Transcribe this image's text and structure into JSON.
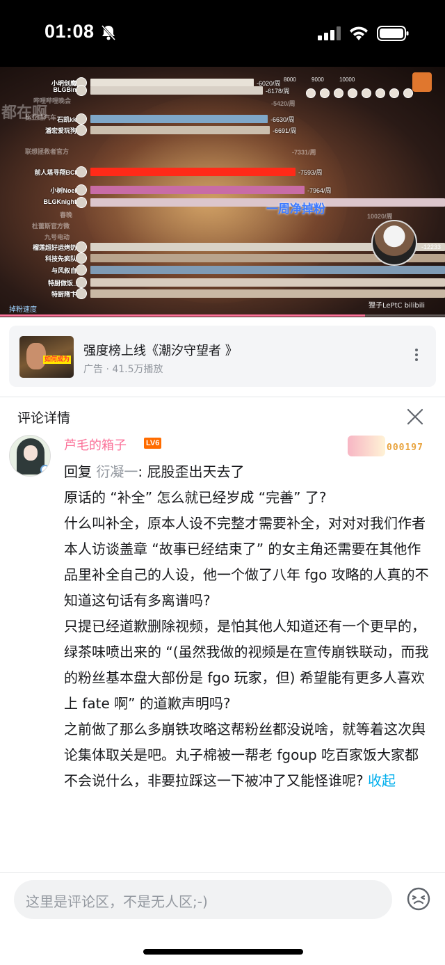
{
  "status": {
    "time": "01:08"
  },
  "video": {
    "axis_ticks": [
      "8000",
      "9000",
      "10000"
    ],
    "ghost_text": "都在啊",
    "bars": [
      {
        "name": "小明剑魔",
        "value": "-6020/周",
        "color": "#e8e2d8"
      },
      {
        "name": "BLGBin",
        "value": "-6178/周",
        "color": "#d8d0c6"
      },
      {
        "name": "石凯kk",
        "value": "-6630/周",
        "color": "#7fa7c8"
      },
      {
        "name": "潘宏爱玩狗",
        "value": "-6691/周",
        "color": "#cbbfae"
      },
      {
        "name": "前人塔寻翔BCI",
        "value": "-7593/周",
        "color": "#ff2a18"
      },
      {
        "name": "小树Noel",
        "value": "-7964/周",
        "color": "#c86ca6"
      },
      {
        "name": "BLGKnight",
        "value": "",
        "color": "#dcc6cc"
      },
      {
        "name": "榴莲超好运烤奶",
        "value": "",
        "color": "#d9d2c6"
      },
      {
        "name": "科技先疯队",
        "value": "",
        "color": "#b9a48d"
      },
      {
        "name": "与风叙自",
        "value": "",
        "color": "#7f9bb5"
      },
      {
        "name": "特厨做饭_",
        "value": "",
        "color": "#d8cbbd"
      },
      {
        "name": "特厨隋卞",
        "value": "",
        "color": "#c9b8a4"
      }
    ],
    "dim_labels": [
      "哔哩哔哩晚会",
      "比亚迪汽车",
      "联想拯救者官方",
      "春晚",
      "杜蕾斯官方微",
      "九号电动"
    ],
    "dim_values": [
      "-5420/周",
      "-7331/周",
      "10020/周"
    ],
    "caption": "一周净掉粉",
    "chef_value": "-12233",
    "speed_label": "掉粉速度",
    "watermark": "狸子LePtC bilibili",
    "progress": 0.82
  },
  "ad": {
    "thumb_tag": "如何成为",
    "title": "强度榜上线《潮汐守望者 》",
    "subtitle": "广告 · 41.5万播放"
  },
  "panel": {
    "title": "评论详情"
  },
  "comment": {
    "username": "芦毛的箱子",
    "level": "LV6",
    "fan_number": "000197",
    "reply_prefix": "回复 ",
    "reply_name": "衍凝一",
    "reply_text": ": 屁股歪出天去了",
    "paragraphs": [
      "原话的 “补全” 怎么就已经岁成 “完善” 了?",
      "什么叫补全，原本人设不完整才需要补全，对对对我们作者本人访谈盖章 “故事已经结束了” 的女主角还需要在其他作品里补全自己的人设，他一个做了八年 fgo 攻略的人真的不知道这句话有多离谱吗?",
      "只提已经道歉删除视频，是怕其他人知道还有一个更早的，绿茶味喷出来的 “(虽然我做的视频是在宣传崩铁联动，而我的粉丝基本盘大部份是 fgo 玩家，但) 希望能有更多人喜欢上 fate 啊” 的道歉声明吗?"
    ],
    "last_paragraph": "之前做了那么多崩铁攻略这帮粉丝都没说啥，就等着这次舆论集体取关是吧。丸子棉被一帮老 fgoup 吃百家饭大家都不会说什么，非要拉踩这一下被冲了又能怪谁呢?",
    "collapse_label": "收起"
  },
  "input": {
    "placeholder": "这里是评论区，不是无人区;-)"
  },
  "colors": {
    "accent_pink": "#fb7299",
    "link_blue": "#00aeec",
    "level_orange": "#ff6c00"
  }
}
